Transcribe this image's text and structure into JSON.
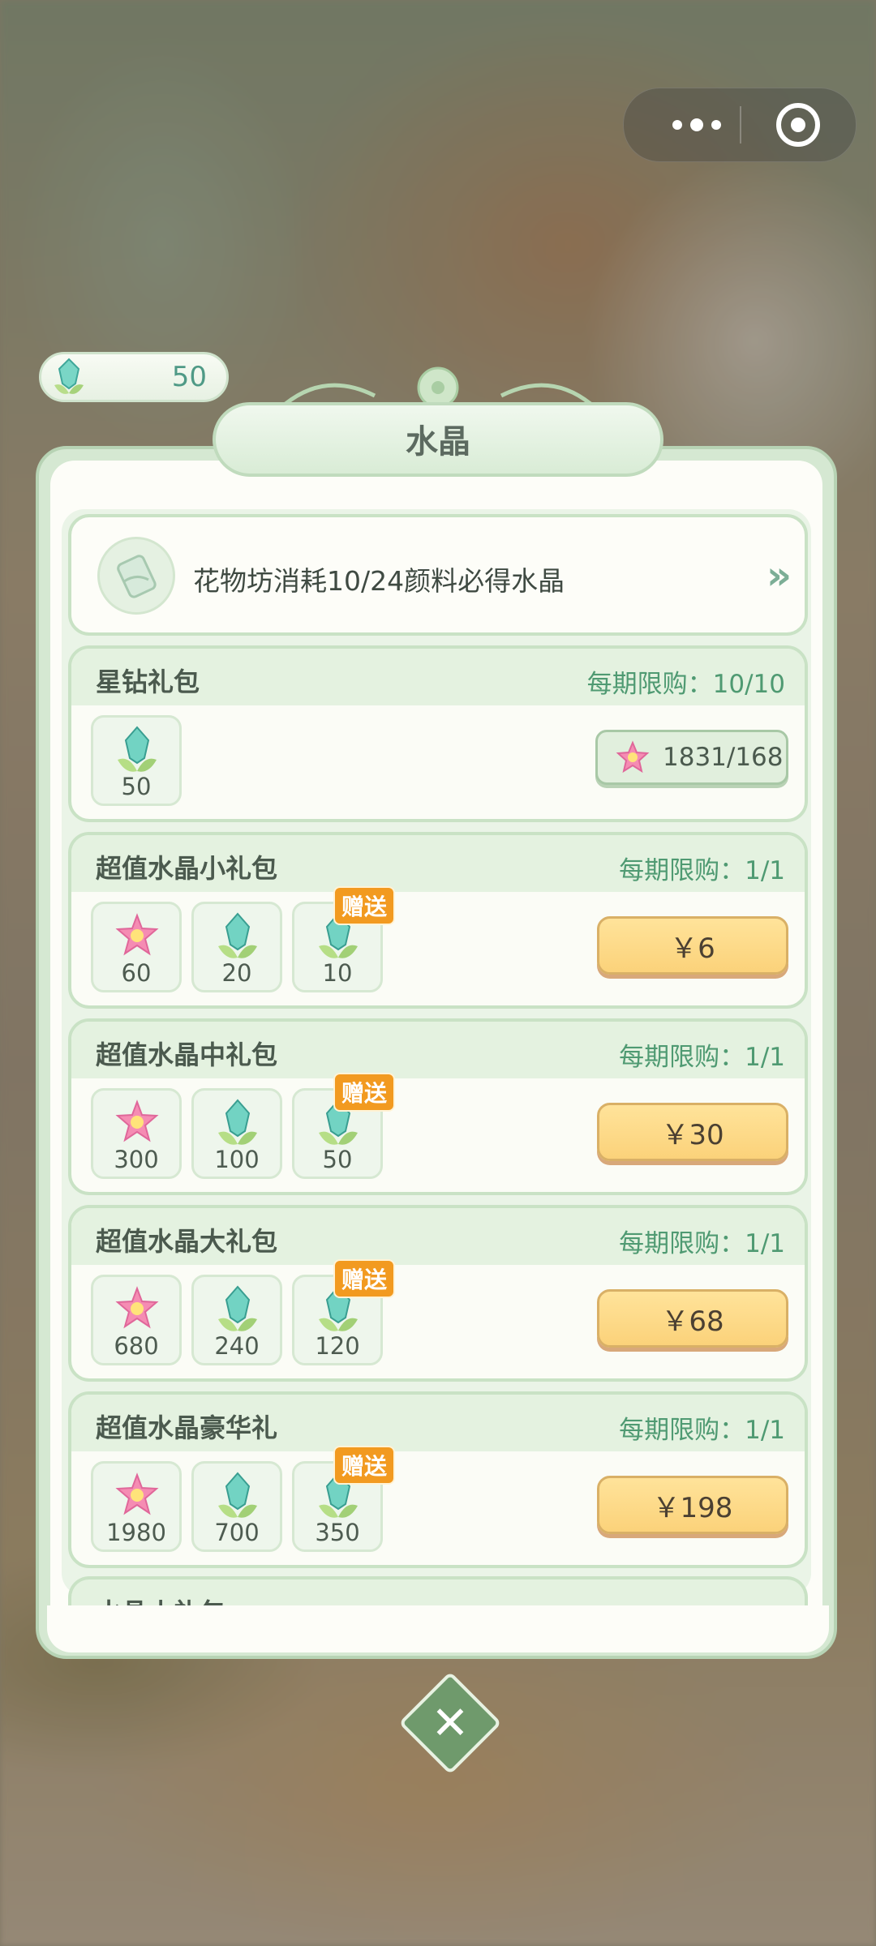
{
  "currency": {
    "value": "50"
  },
  "panel": {
    "title": "水晶"
  },
  "notice": {
    "text": "花物坊消耗10/24颜料必得水晶",
    "arrow": "»"
  },
  "packs": [
    {
      "name": "星钻礼包",
      "limit": "每期限购：10/10",
      "items": [
        {
          "type": "crystal",
          "qty": "50"
        }
      ],
      "price_label": "1831/168",
      "price_type": "star"
    },
    {
      "name": "超值水晶小礼包",
      "limit": "每期限购：1/1",
      "items": [
        {
          "type": "star",
          "qty": "60"
        },
        {
          "type": "crystal",
          "qty": "20"
        },
        {
          "type": "crystal",
          "qty": "10",
          "gift": "赠送"
        }
      ],
      "price_label": "￥6"
    },
    {
      "name": "超值水晶中礼包",
      "limit": "每期限购：1/1",
      "items": [
        {
          "type": "star",
          "qty": "300"
        },
        {
          "type": "crystal",
          "qty": "100"
        },
        {
          "type": "crystal",
          "qty": "50",
          "gift": "赠送"
        }
      ],
      "price_label": "￥30"
    },
    {
      "name": "超值水晶大礼包",
      "limit": "每期限购：1/1",
      "items": [
        {
          "type": "star",
          "qty": "680"
        },
        {
          "type": "crystal",
          "qty": "240"
        },
        {
          "type": "crystal",
          "qty": "120",
          "gift": "赠送"
        }
      ],
      "price_label": "￥68"
    },
    {
      "name": "超值水晶豪华礼",
      "limit": "每期限购：1/1",
      "items": [
        {
          "type": "star",
          "qty": "1980"
        },
        {
          "type": "crystal",
          "qty": "700"
        },
        {
          "type": "crystal",
          "qty": "350",
          "gift": "赠送"
        }
      ],
      "price_label": "￥198"
    }
  ],
  "peek": {
    "name": "水晶小礼包"
  },
  "colors": {
    "accent": "#4f9a72",
    "button": "#fbd27a",
    "panel": "#d5e8d2"
  },
  "icons": {
    "crystal": "crystal-icon",
    "star": "star-icon",
    "close": "close-icon"
  }
}
